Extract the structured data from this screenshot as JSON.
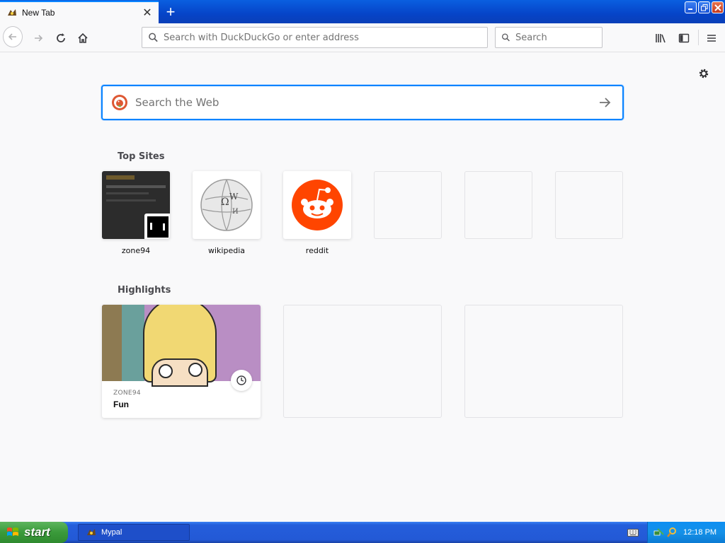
{
  "browser": {
    "tab": {
      "title": "New Tab",
      "close_glyph": "✕"
    },
    "new_tab_glyph": "+",
    "nav": {
      "url_placeholder": "Search with DuckDuckGo or enter address",
      "search_placeholder": "Search"
    }
  },
  "newtab": {
    "search_placeholder": "Search the Web",
    "top_sites_title": "Top Sites",
    "top_sites": [
      {
        "label": "zone94"
      },
      {
        "label": "wikipedia"
      },
      {
        "label": "reddit"
      },
      {
        "label": ""
      },
      {
        "label": ""
      },
      {
        "label": ""
      }
    ],
    "highlights_title": "Highlights",
    "highlights": [
      {
        "source": "ZONE94",
        "title": "Fun"
      }
    ]
  },
  "taskbar": {
    "start_label": "start",
    "task_item_label": "Mypal",
    "clock": "12:18 PM"
  },
  "colors": {
    "accent": "#0a84ff",
    "reddit": "#ff4500",
    "taskbar": "#245edb",
    "start": "#3a9a3a"
  }
}
